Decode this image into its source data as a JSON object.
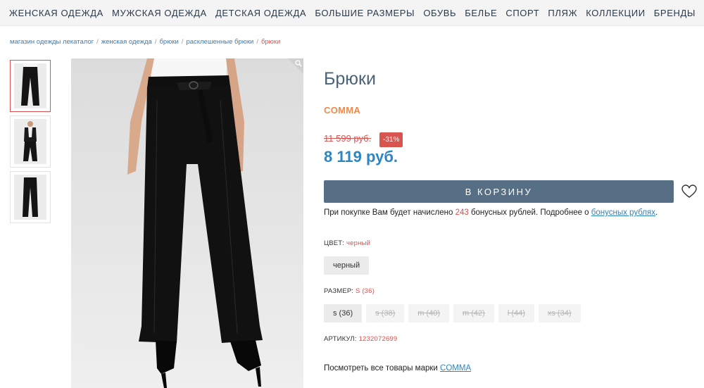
{
  "nav": [
    "ЖЕНСКАЯ ОДЕЖДА",
    "МУЖСКАЯ ОДЕЖДА",
    "ДЕТСКАЯ ОДЕЖДА",
    "БОЛЬШИЕ РАЗМЕРЫ",
    "ОБУВЬ",
    "БЕЛЬЕ",
    "СПОРТ",
    "ПЛЯЖ",
    "КОЛЛЕКЦИИ",
    "БРЕНДЫ"
  ],
  "breadcrumb": {
    "items": [
      "магазин одежды лекаталог",
      "женская одежда",
      "брюки",
      "расклешенные брюки"
    ],
    "separator": "/",
    "current": "брюки"
  },
  "product": {
    "title": "Брюки",
    "brand": "COMMA",
    "old_price": "11 599 руб.",
    "discount": "-31%",
    "price": "8 119 руб.",
    "cart_label": "В КОРЗИНУ",
    "bonus": {
      "before": "При покупке Вам будет начислено ",
      "amount": "243",
      "middle": " бонусных рублей. Подробнее о ",
      "link": "бонусных рублях",
      "after": "."
    },
    "color": {
      "label": "ЦВЕТ:",
      "value": "черный",
      "options": [
        "черный"
      ]
    },
    "size": {
      "label": "РАЗМЕР:",
      "value": "S (36)",
      "options": [
        {
          "label": "s (36)",
          "available": true
        },
        {
          "label": "s (38)",
          "available": false
        },
        {
          "label": "m (40)",
          "available": false
        },
        {
          "label": "m (42)",
          "available": false
        },
        {
          "label": "l (44)",
          "available": false
        },
        {
          "label": "xs (34)",
          "available": false
        }
      ]
    },
    "article": {
      "label": "АРТИКУЛ:",
      "value": "1232072699"
    },
    "see_all": {
      "text": "Посмотреть все товары марки ",
      "link": "COMMA"
    }
  },
  "colors": {
    "nav_text": "#2b3a48",
    "link": "#2e86c1",
    "accent_red": "#d9534f",
    "brand_orange": "#ef8a47",
    "title": "#4a6377",
    "cart_button": "#566f85"
  },
  "icons": [
    "zoom-icon",
    "heart-icon"
  ]
}
